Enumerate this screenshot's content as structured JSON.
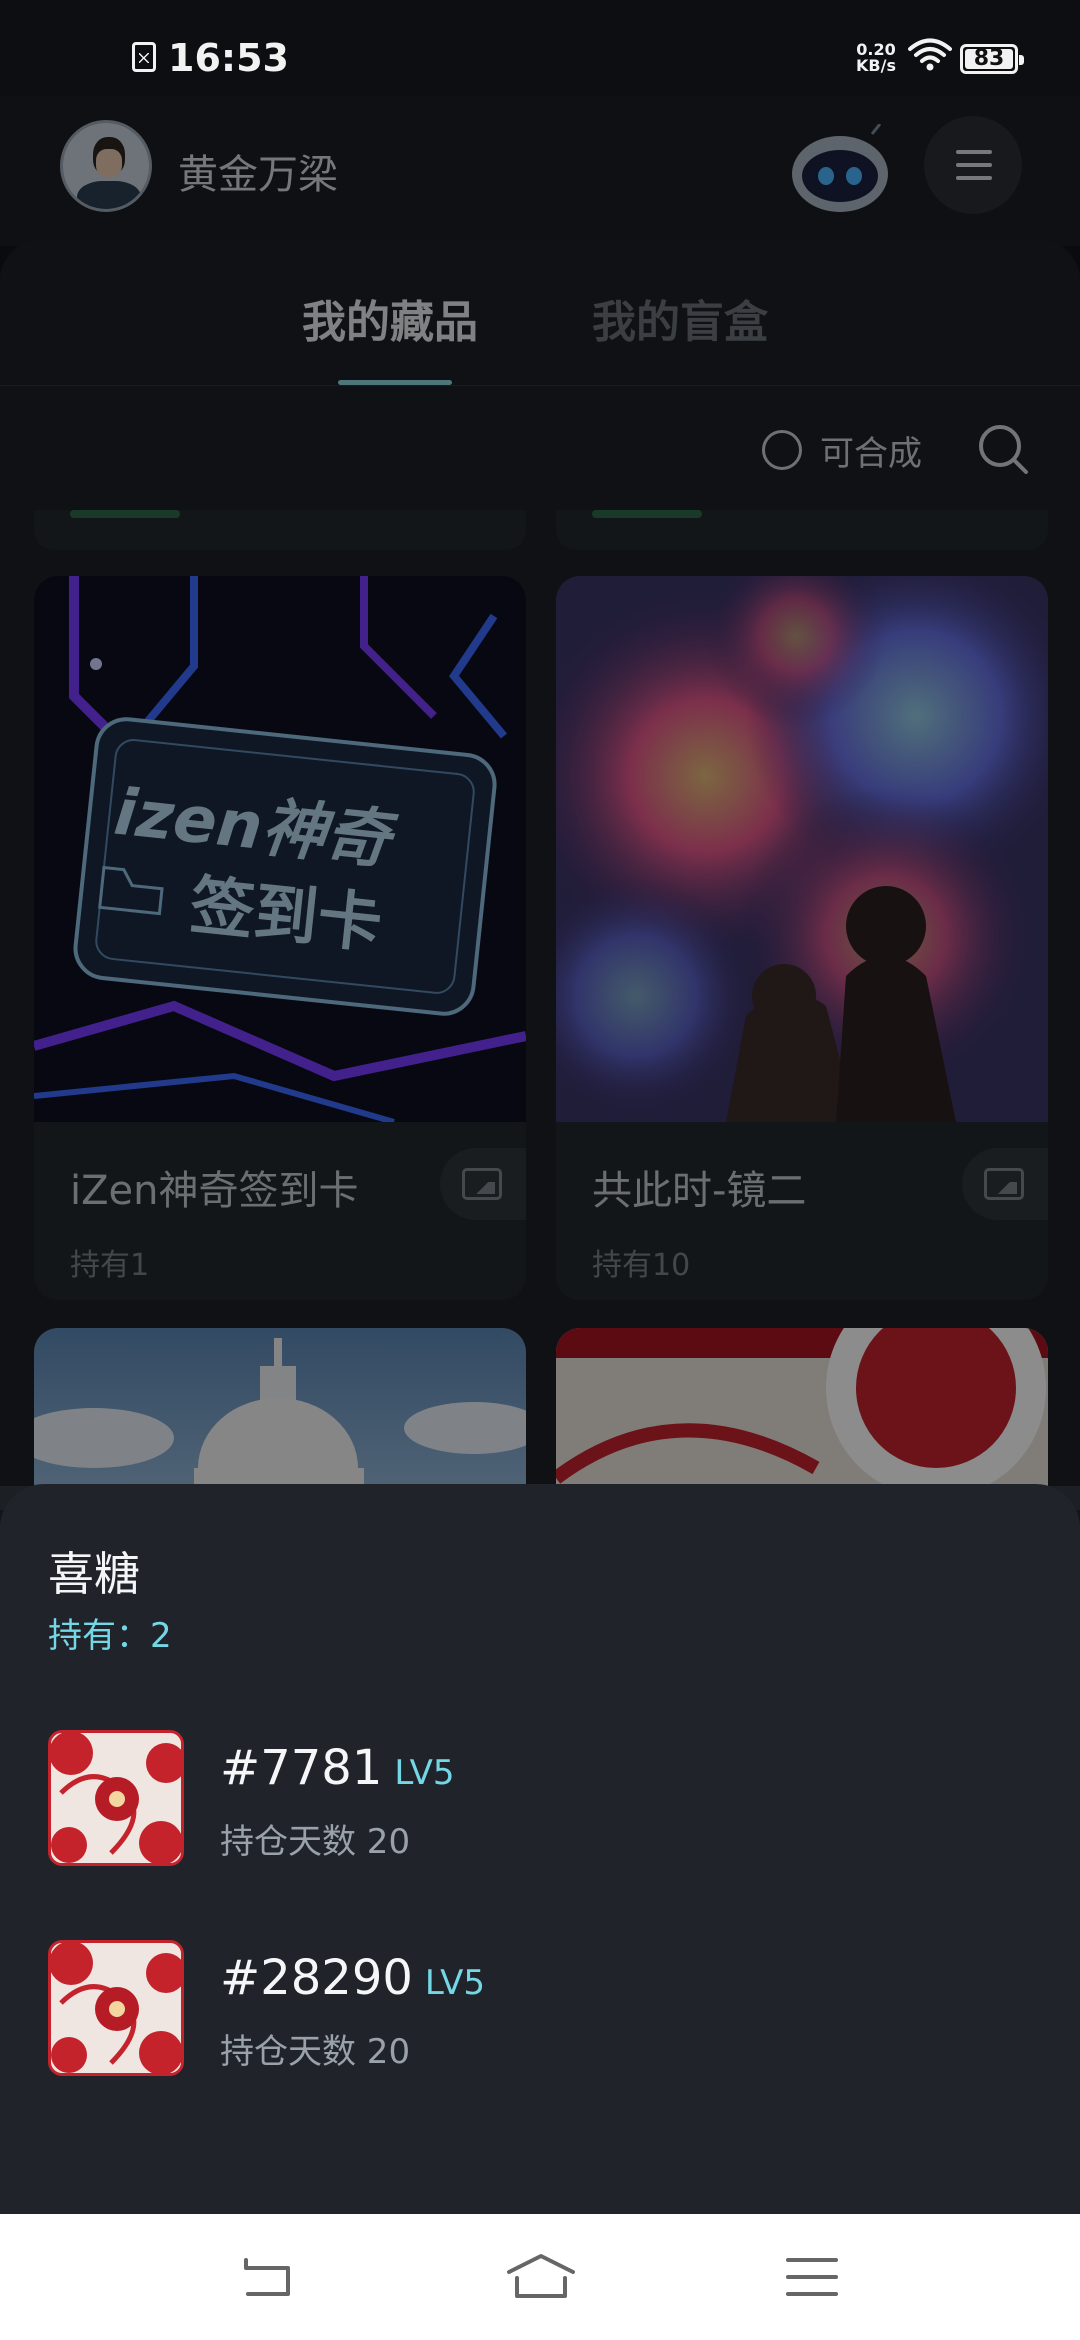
{
  "status_bar": {
    "time": "16:53",
    "net_speed_value": "0.20",
    "net_speed_unit": "KB/s",
    "battery": "83"
  },
  "header": {
    "username": "黄金万梁"
  },
  "tabs": [
    {
      "label": "我的藏品",
      "active": true
    },
    {
      "label": "我的盲盒",
      "active": false
    }
  ],
  "filter": {
    "composable_label": "可合成"
  },
  "cards": [
    {
      "title": "iZen神奇签到卡",
      "hold": "持有1",
      "image_text_line1": "izen神奇",
      "image_text_line2": "签到卡"
    },
    {
      "title": "共此时-镜二",
      "hold": "持有10"
    }
  ],
  "sheet": {
    "name": "喜糖",
    "owned": "持有：2",
    "items": [
      {
        "number": "#7781",
        "level": "LV5",
        "days": "持仓天数 20"
      },
      {
        "number": "#28290",
        "level": "LV5",
        "days": "持仓天数 20"
      }
    ]
  },
  "colors": {
    "accent": "#74d7e6",
    "sheet_bg": "#20242a",
    "page_bg": "#12151a"
  }
}
